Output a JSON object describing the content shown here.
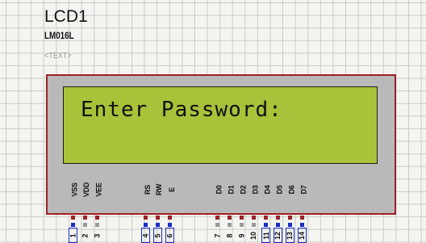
{
  "component": {
    "name": "LCD1",
    "model": "LM016L",
    "text_placeholder": "<TEXT>"
  },
  "lcd": {
    "line1": "Enter Password:"
  },
  "colors": {
    "screen_bg": "#a8c23a",
    "body_bg": "#b9b9b9",
    "border": "#9e2127",
    "pin_active": "#1a2cc4",
    "pin_inactive": "#9a9a9a"
  },
  "pins": [
    {
      "label": "VSS",
      "num": "1",
      "state": "active"
    },
    {
      "label": "VDD",
      "num": "2",
      "state": "inactive"
    },
    {
      "label": "VEE",
      "num": "3",
      "state": "inactive"
    },
    {
      "label": "RS",
      "num": "4",
      "state": "active"
    },
    {
      "label": "RW",
      "num": "5",
      "state": "active"
    },
    {
      "label": "E",
      "num": "6",
      "state": "active"
    },
    {
      "label": "D0",
      "num": "7",
      "state": "inactive"
    },
    {
      "label": "D1",
      "num": "8",
      "state": "inactive"
    },
    {
      "label": "D2",
      "num": "9",
      "state": "inactive"
    },
    {
      "label": "D3",
      "num": "10",
      "state": "inactive"
    },
    {
      "label": "D4",
      "num": "11",
      "state": "active"
    },
    {
      "label": "D5",
      "num": "12",
      "state": "active"
    },
    {
      "label": "D6",
      "num": "13",
      "state": "active"
    },
    {
      "label": "D7",
      "num": "14",
      "state": "active"
    }
  ]
}
